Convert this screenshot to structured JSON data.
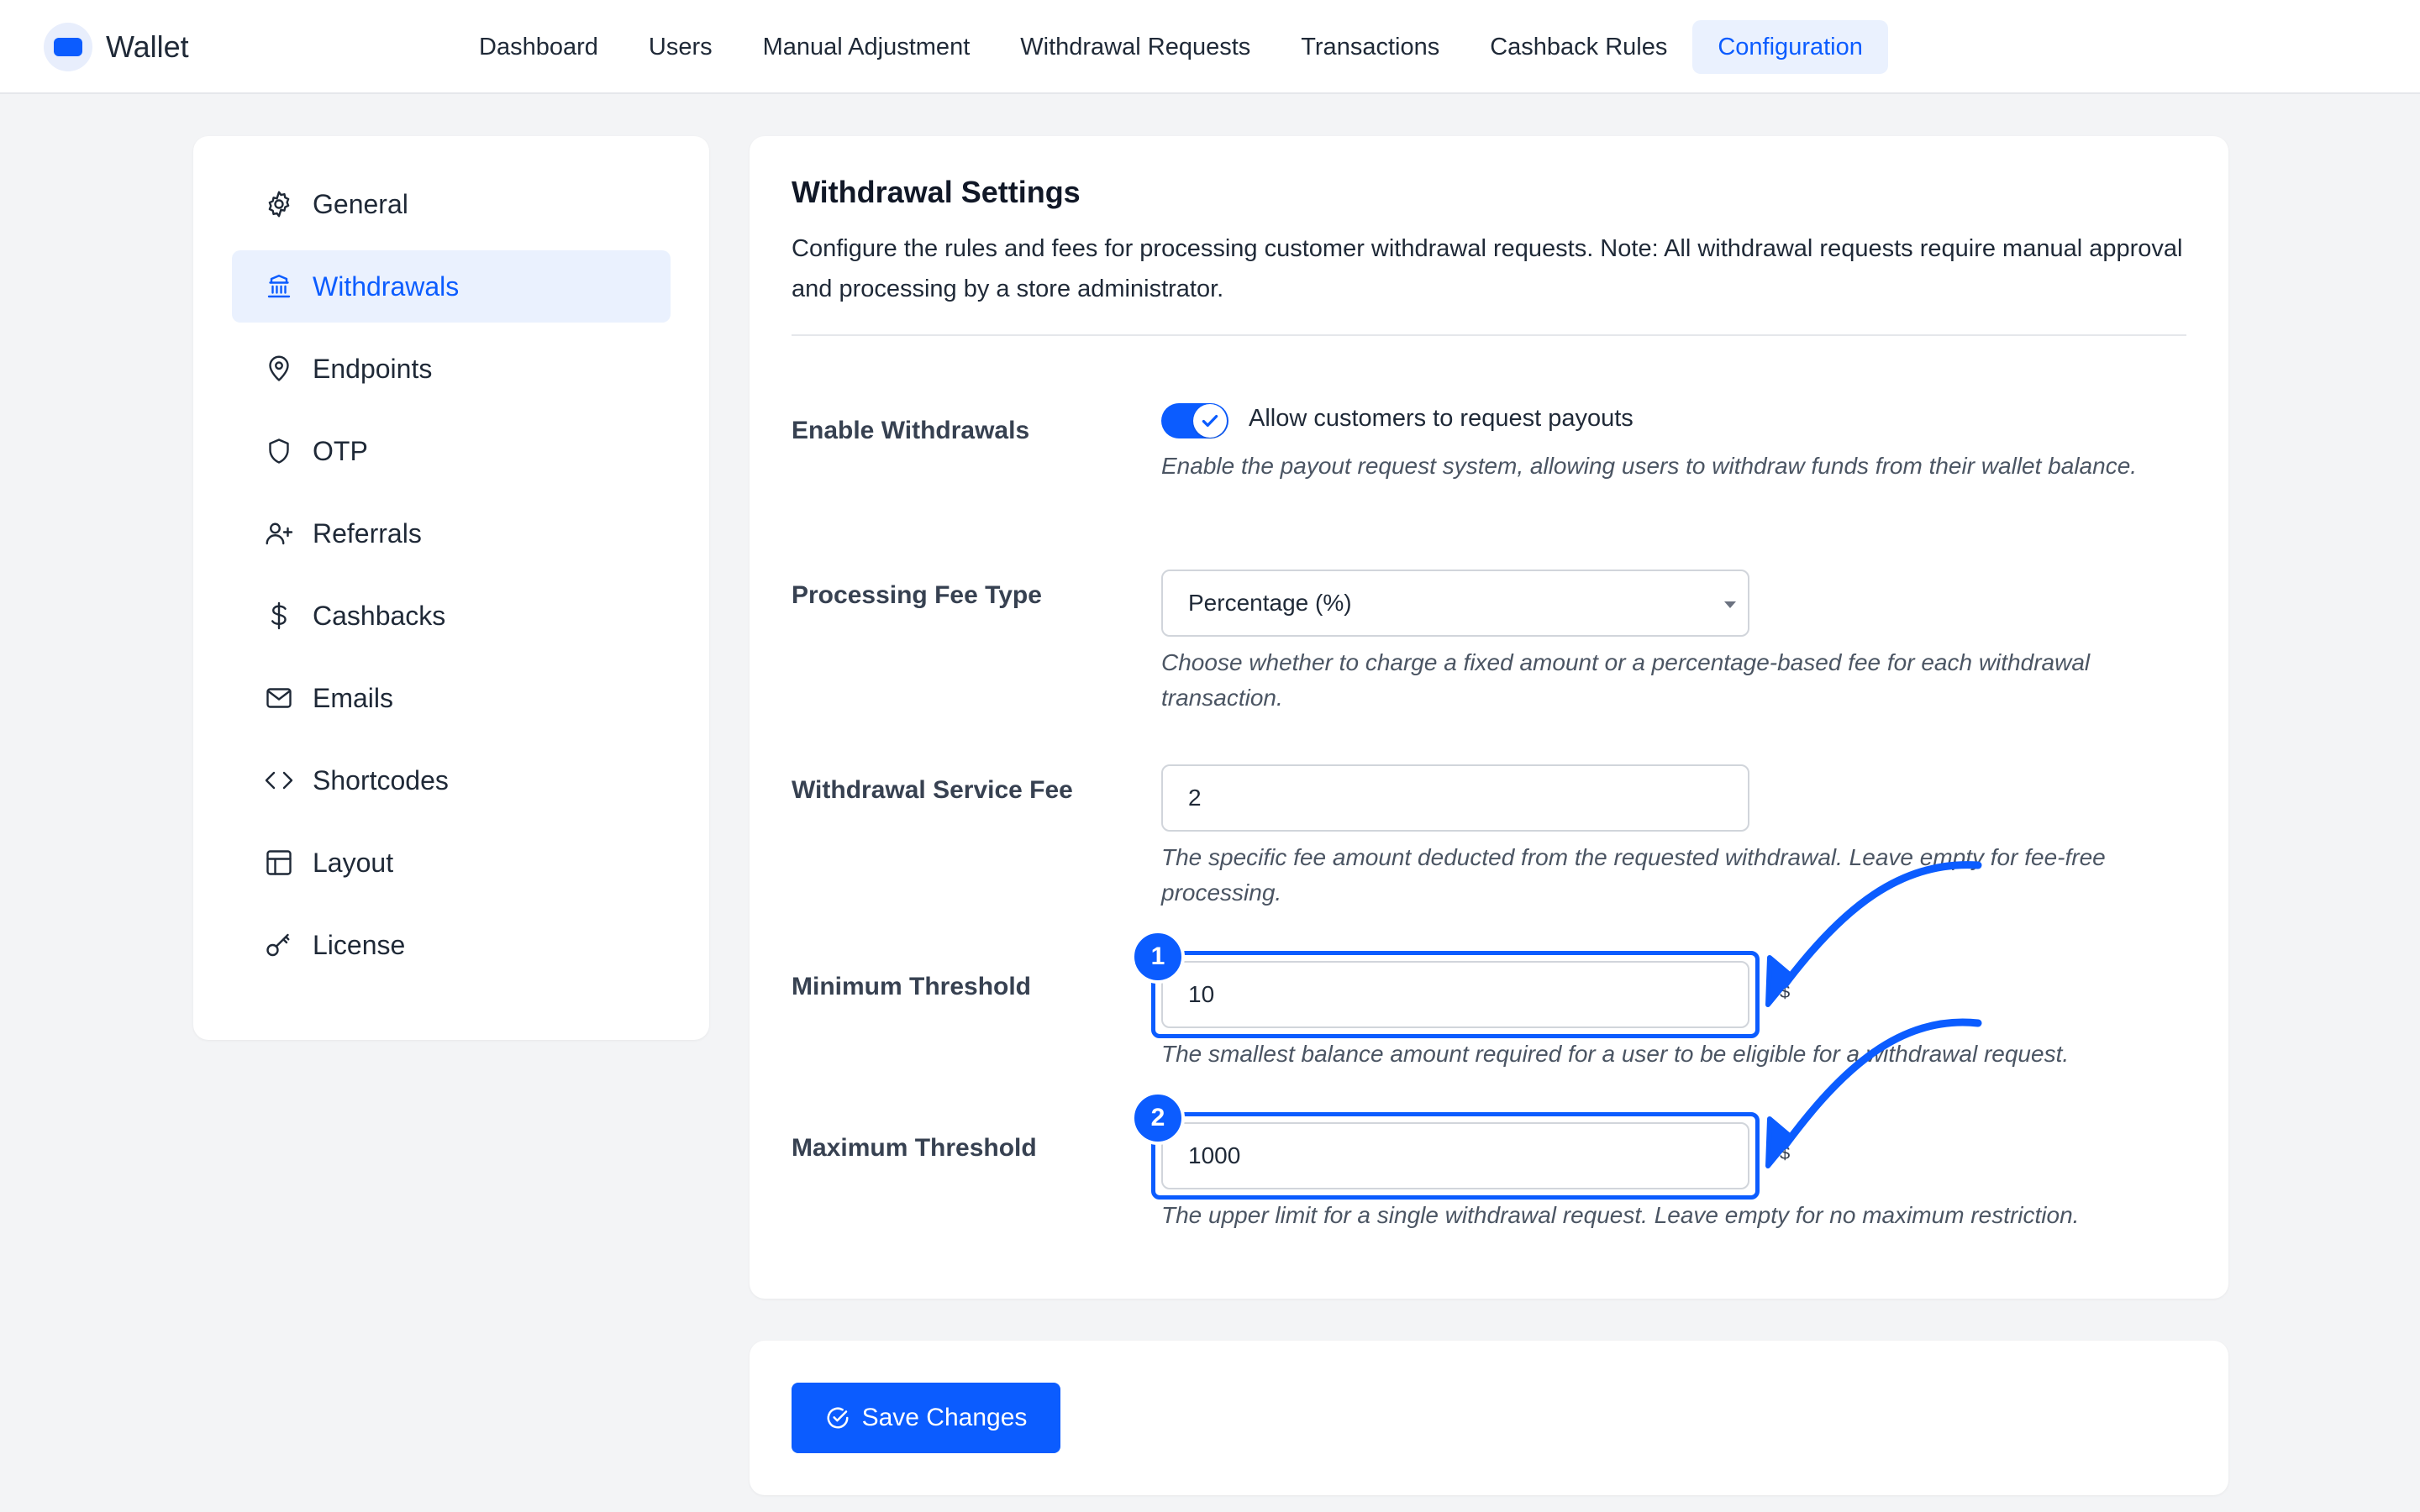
{
  "brand": {
    "name": "Wallet",
    "icon": "wallet-icon"
  },
  "nav": {
    "items": [
      {
        "label": "Dashboard"
      },
      {
        "label": "Users"
      },
      {
        "label": "Manual Adjustment"
      },
      {
        "label": "Withdrawal Requests"
      },
      {
        "label": "Transactions"
      },
      {
        "label": "Cashback Rules"
      },
      {
        "label": "Configuration",
        "active": true
      }
    ]
  },
  "sidebar": {
    "items": [
      {
        "label": "General",
        "icon": "gear-icon"
      },
      {
        "label": "Withdrawals",
        "icon": "bank-icon",
        "active": true
      },
      {
        "label": "Endpoints",
        "icon": "map-pin-icon"
      },
      {
        "label": "OTP",
        "icon": "shield-icon"
      },
      {
        "label": "Referrals",
        "icon": "user-plus-icon"
      },
      {
        "label": "Cashbacks",
        "icon": "dollar-icon"
      },
      {
        "label": "Emails",
        "icon": "mail-icon"
      },
      {
        "label": "Shortcodes",
        "icon": "code-icon"
      },
      {
        "label": "Layout",
        "icon": "layout-icon"
      },
      {
        "label": "License",
        "icon": "key-icon"
      }
    ]
  },
  "settings": {
    "title": "Withdrawal Settings",
    "description": "Configure the rules and fees for processing customer withdrawal requests. Note: All withdrawal requests require manual approval and processing by a store administrator.",
    "enable": {
      "label": "Enable Withdrawals",
      "toggle_label": "Allow customers to request payouts",
      "enabled": true,
      "help": "Enable the payout request system, allowing users to withdraw funds from their wallet balance."
    },
    "fee_type": {
      "label": "Processing Fee Type",
      "selected": "Percentage (%)",
      "help": "Choose whether to charge a fixed amount or a percentage-based fee for each withdrawal transaction."
    },
    "service_fee": {
      "label": "Withdrawal Service Fee",
      "value": "2",
      "help": "The specific fee amount deducted from the requested withdrawal. Leave empty for fee-free processing."
    },
    "min_threshold": {
      "label": "Minimum Threshold",
      "value": "10",
      "suffix": "$",
      "badge": "1",
      "help": "The smallest balance amount required for a user to be eligible for a withdrawal request."
    },
    "max_threshold": {
      "label": "Maximum Threshold",
      "value": "1000",
      "suffix": "$",
      "badge": "2",
      "help": "The upper limit for a single withdrawal request. Leave empty for no maximum restriction."
    }
  },
  "footer": {
    "save_label": "Save Changes",
    "save_icon": "check-circle-icon"
  },
  "colors": {
    "accent": "#0b5cff",
    "accent_soft": "#eaf1fe",
    "background": "#f3f4f6"
  }
}
